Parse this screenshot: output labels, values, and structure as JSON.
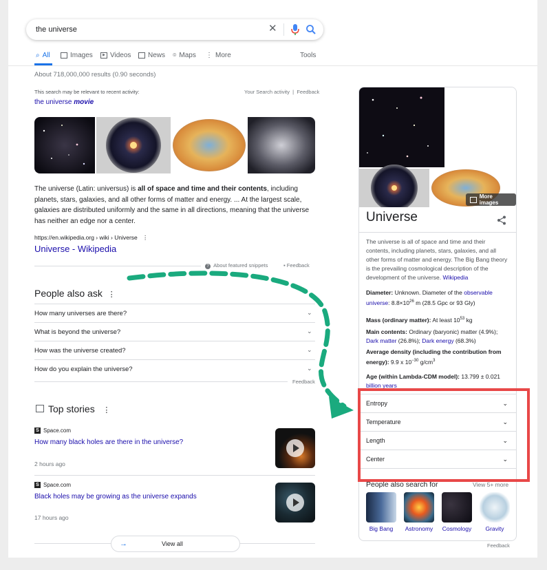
{
  "search": {
    "query": "the universe"
  },
  "tabs": [
    {
      "label": "All",
      "icon": "search-icon"
    },
    {
      "label": "Images",
      "icon": "image-icon"
    },
    {
      "label": "Videos",
      "icon": "play-box-icon"
    },
    {
      "label": "News",
      "icon": "newspaper-icon"
    },
    {
      "label": "Maps",
      "icon": "pin-icon"
    },
    {
      "label": "More",
      "icon": "kebab-icon"
    }
  ],
  "tools_label": "Tools",
  "stats": "About 718,000,000 results (0.90 seconds)",
  "recent": {
    "note": "This search may be relevant to recent activity:",
    "your_activity": "Your Search activity",
    "feedback": "Feedback",
    "link_prefix": "the universe",
    "link_em": "movie"
  },
  "snippet": {
    "text_a": "The universe (Latin: universus) is ",
    "text_bold": "all of space and time and their contents",
    "text_b": ", including planets, stars, galaxies, and all other forms of matter and energy. ... At the largest scale, galaxies are distributed uniformly and the same in all directions, meaning that the universe has neither an edge nor a center.",
    "url": "https://en.wikipedia.org › wiki › Universe",
    "title": "Universe - Wikipedia",
    "about": "About featured snippets",
    "feedback": "Feedback"
  },
  "paa": {
    "title": "People also ask",
    "questions": [
      "How many universes are there?",
      "What is beyond the universe?",
      "How was the universe created?",
      "How do you explain the universe?"
    ],
    "feedback": "Feedback"
  },
  "top_stories": {
    "title": "Top stories",
    "stories": [
      {
        "source": "Space.com",
        "title": "How many black holes are there in the universe?",
        "time": "2 hours ago"
      },
      {
        "source": "Space.com",
        "title": "Black holes may be growing as the universe expands",
        "time": "17 hours ago"
      }
    ],
    "view_all": "View all"
  },
  "kp": {
    "more_images": "More images",
    "title": "Universe",
    "desc": "The universe is all of space and time and their contents, including planets, stars, galaxies, and all other forms of matter and energy. The Big Bang theory is the prevailing cosmological description of the development of the universe.",
    "desc_link": "Wikipedia",
    "diameter_label": "Diameter:",
    "diameter_a": "Unknown. Diameter of the",
    "diameter_link": "observable universe",
    "diameter_b": ": 8.8×10",
    "diameter_exp": "26",
    "diameter_c": " m (28.5 Gpc or 93 Gly)",
    "mass_label": "Mass (ordinary matter):",
    "mass_a": "At least 10",
    "mass_exp": "53",
    "mass_b": " kg",
    "contents_label": "Main contents:",
    "contents_a": "Ordinary (baryonic) matter (4.9%);",
    "contents_link1": "Dark matter",
    "contents_b": " (26.8%);",
    "contents_link2": "Dark energy",
    "contents_c": " (68.3%)",
    "density_label": "Average density (including the contribution from energy):",
    "density_a": "9.9 x 10",
    "density_exp": "−30",
    "density_b": " g/cm",
    "density_exp2": "3",
    "age_label": "Age (within Lambda-CDM model):",
    "age_a": "13.799 ± 0.021",
    "age_link": "billion years",
    "accordion": [
      "Entropy",
      "Temperature",
      "Length",
      "Center"
    ],
    "pas_title": "People also search for",
    "pas_more": "View 5+ more",
    "pas_items": [
      "Big Bang",
      "Astronomy",
      "Cosmology",
      "Gravity"
    ],
    "feedback": "Feedback"
  },
  "colors": {
    "accent": "#1a73e8",
    "link": "#1a0dab",
    "highlight_box": "#e84848",
    "arrow": "#1aaa7e"
  }
}
